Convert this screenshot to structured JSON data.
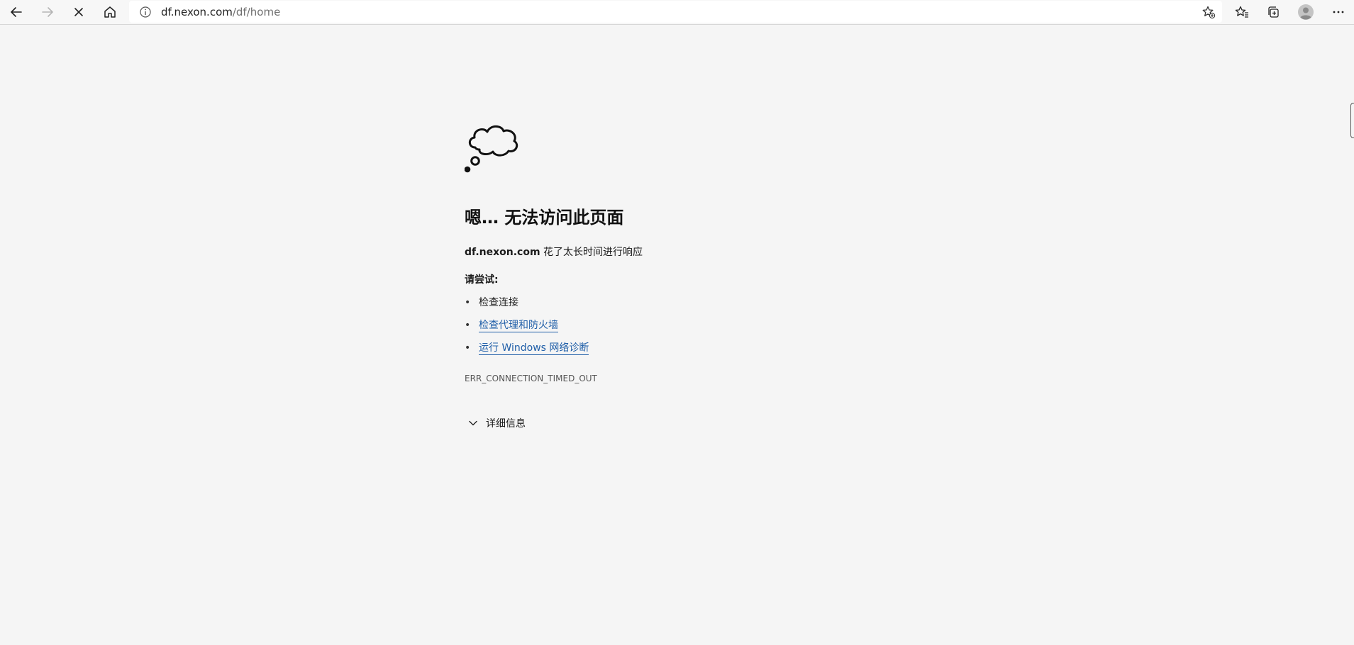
{
  "browser": {
    "address": {
      "domain": "df.nexon.com",
      "path": "/df/home"
    },
    "icons": {
      "back": "back-arrow-icon",
      "forward": "forward-arrow-icon",
      "stop": "stop-loading-icon",
      "home": "home-icon",
      "site_info": "site-info-icon",
      "add_favorite": "add-favorite-icon",
      "favorites": "favorites-icon",
      "collections": "collections-icon",
      "profile": "profile-avatar-icon",
      "more": "more-menu-icon"
    }
  },
  "error_page": {
    "title": "嗯… 无法访问此页面",
    "message_host": "df.nexon.com",
    "message_rest": " 花了太长时间进行响应",
    "try_label": "请尝试:",
    "suggestions": [
      {
        "bullet": "•",
        "text": "检查连接",
        "is_link": false
      },
      {
        "bullet": "•",
        "text": "检查代理和防火墙",
        "is_link": true
      },
      {
        "bullet": "•",
        "text": "运行 Windows 网络诊断",
        "is_link": true
      }
    ],
    "error_code": "ERR_CONNECTION_TIMED_OUT",
    "details_label": "详细信息",
    "icon": "thought-cloud-icon"
  },
  "colors": {
    "page_bg": "#f5f5f5",
    "link": "#1f5ea8",
    "text": "#1b1b1b"
  }
}
